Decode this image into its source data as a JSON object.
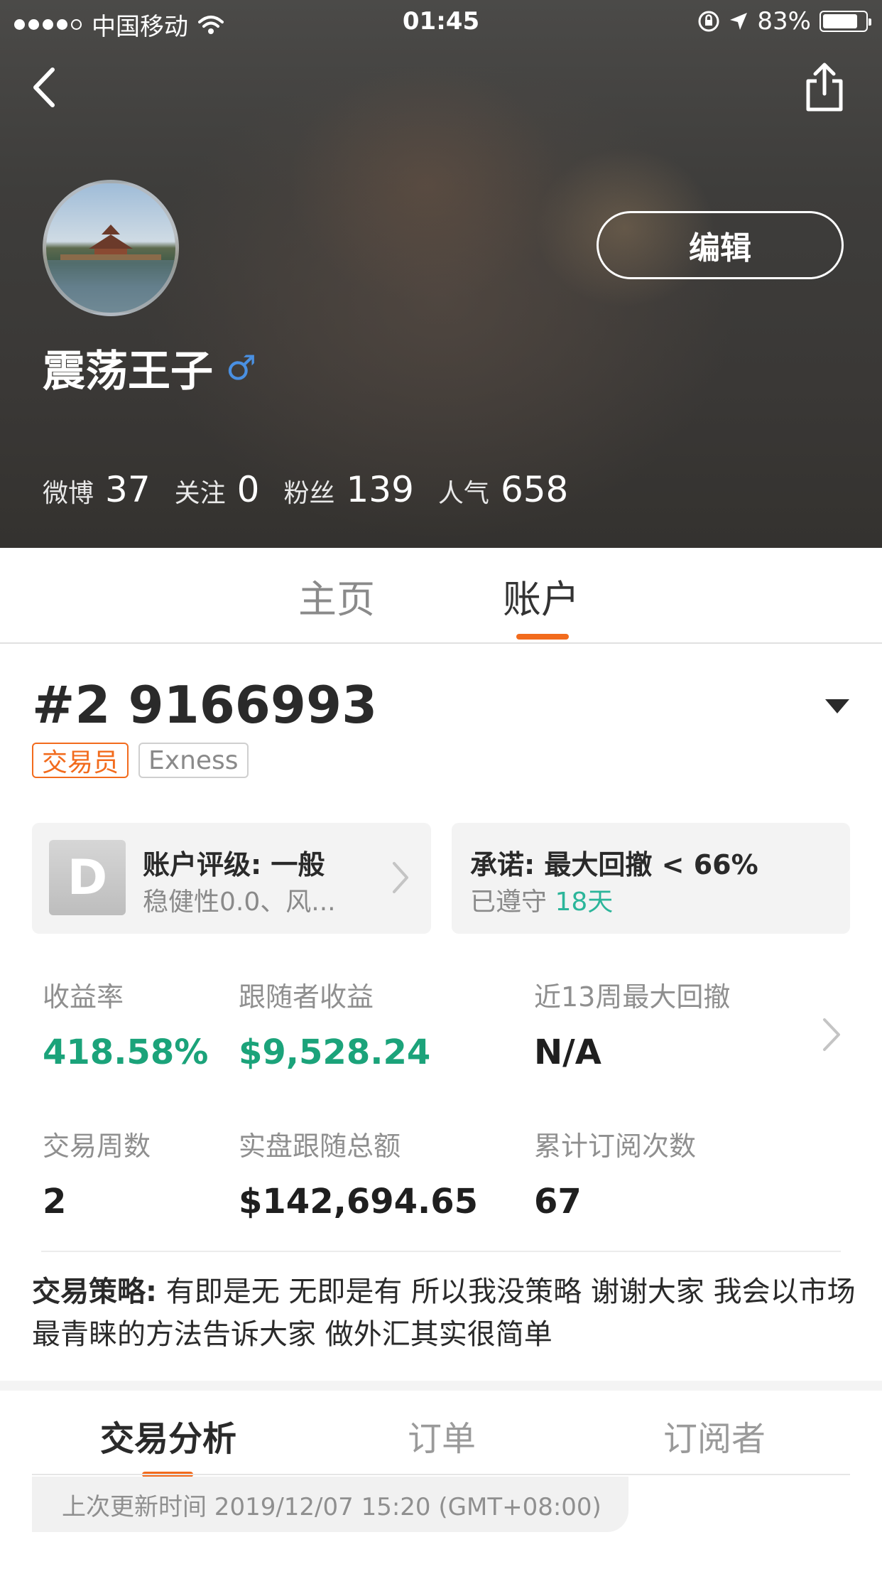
{
  "status_bar": {
    "carrier": "中国移动",
    "time": "01:45",
    "battery_percent": "83%",
    "battery_level": 0.83
  },
  "header": {
    "edit_label": "编辑",
    "username": "震荡王子",
    "gender_symbol": "♂",
    "stats": [
      {
        "label": "微博",
        "value": "37"
      },
      {
        "label": "关注",
        "value": "0"
      },
      {
        "label": "粉丝",
        "value": "139"
      },
      {
        "label": "人气",
        "value": "658"
      }
    ]
  },
  "main_tabs": [
    {
      "label": "主页",
      "active": false
    },
    {
      "label": "账户",
      "active": true
    }
  ],
  "account": {
    "id": "#2 9166993",
    "tags": {
      "role": "交易员",
      "broker": "Exness"
    },
    "rating_card": {
      "badge": "D",
      "title": "账户评级: 一般",
      "subtitle": "稳健性0.0、风..."
    },
    "promise_card": {
      "title": "承诺: 最大回撤 < 66%",
      "subtitle_prefix": "已遵守",
      "subtitle_days": "18天"
    },
    "metrics": [
      {
        "label": "收益率",
        "value": "418.58%"
      },
      {
        "label": "跟随者收益",
        "value": "$9,528.24"
      },
      {
        "label": "近13周最大回撤",
        "value": "N/A"
      },
      {
        "label": "交易周数",
        "value": "2"
      },
      {
        "label": "实盘跟随总额",
        "value": "$142,694.65"
      },
      {
        "label": "累计订阅次数",
        "value": "67"
      }
    ],
    "strategy": {
      "label": "交易策略:",
      "text": "有即是无 无即是有 所以我没策略 谢谢大家 我会以市场最青睐的方法告诉大家 做外汇其实很简单"
    }
  },
  "sub_tabs": [
    {
      "label": "交易分析",
      "active": true
    },
    {
      "label": "订单",
      "active": false
    },
    {
      "label": "订阅者",
      "active": false
    }
  ],
  "last_update": "上次更新时间 2019/12/07 15:20 (GMT+08:00)",
  "colors": {
    "accent_orange": "#f26b1d",
    "positive_green": "#1ba37a",
    "teal": "#2bb59a",
    "gender_blue": "#4a90e2"
  },
  "icons": [
    "back-icon",
    "share-icon",
    "wifi-icon",
    "lock-rotation-icon",
    "location-arrow-icon",
    "battery-icon",
    "male-icon",
    "dropdown-triangle-icon",
    "chevron-right-icon"
  ]
}
